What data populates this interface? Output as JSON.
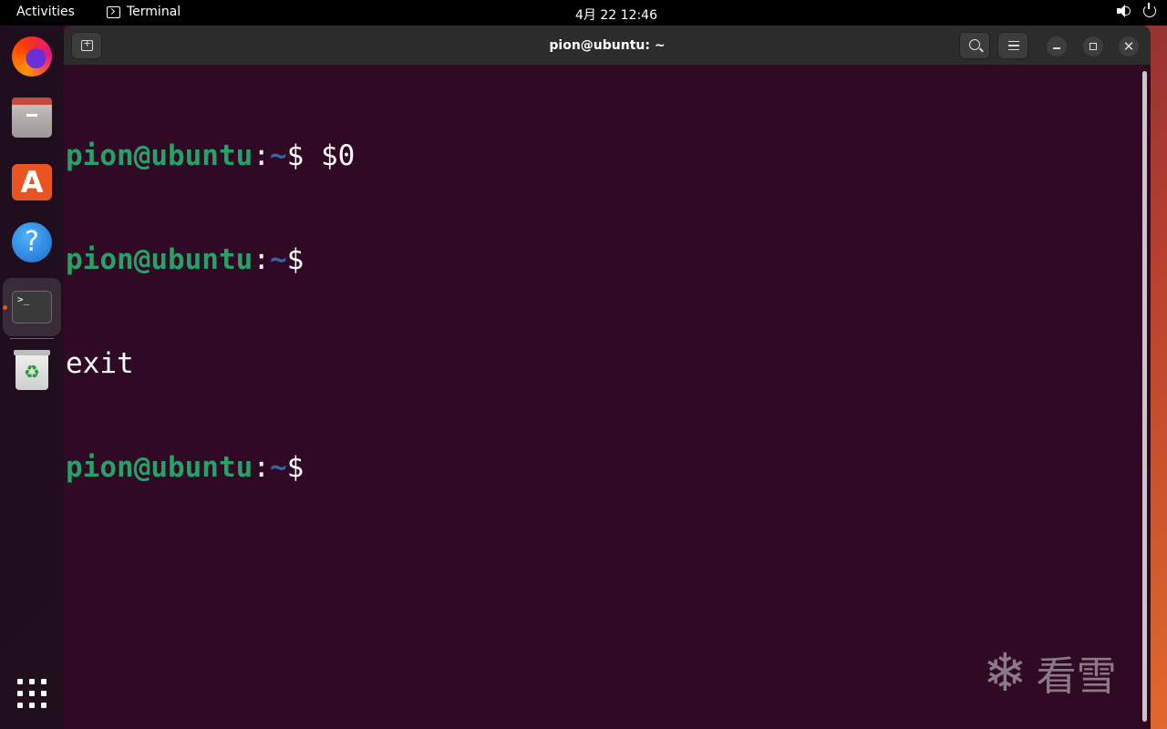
{
  "topbar": {
    "activities": "Activities",
    "app_name": "Terminal",
    "clock": "4月 22  12:46"
  },
  "dock": {
    "items": [
      "firefox-icon",
      "files-icon",
      "app-center-icon",
      "help-icon",
      "terminal-icon",
      "trash-icon",
      "show-apps-icon"
    ],
    "terminal_glyph": ">_",
    "store_glyph": "A",
    "help_glyph": "?",
    "trash_glyph": "♻"
  },
  "window": {
    "title": "pion@ubuntu: ~"
  },
  "terminal": {
    "lines": [
      {
        "user": "pion@ubuntu",
        "sep": ":",
        "path": "~",
        "prompt": "$ ",
        "cmd": "$0"
      },
      {
        "user": "pion@ubuntu",
        "sep": ":",
        "path": "~",
        "prompt": "$",
        "cmd": ""
      },
      {
        "output": "exit"
      },
      {
        "user": "pion@ubuntu",
        "sep": ":",
        "path": "~",
        "prompt": "$",
        "cmd": ""
      }
    ]
  },
  "watermark": {
    "text": "看雪"
  },
  "colors": {
    "terminal_bg": "#300a24",
    "prompt_user": "#26a269",
    "prompt_path": "#3465a4",
    "accent": "#e95420"
  }
}
